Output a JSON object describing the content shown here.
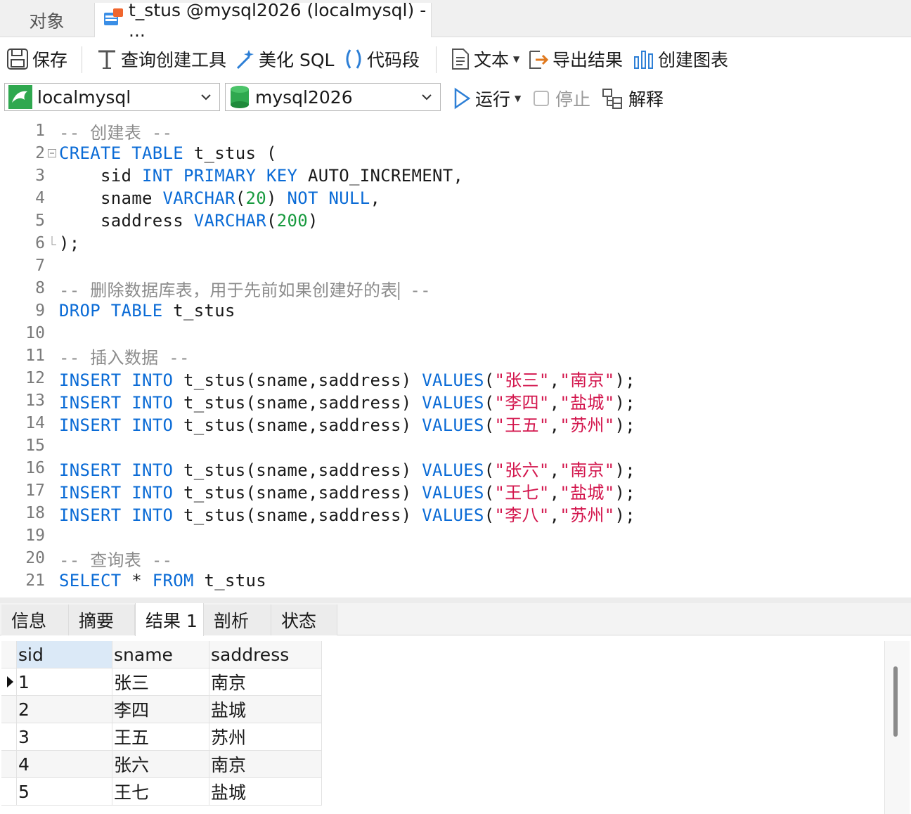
{
  "window_tabs": {
    "objects": "对象",
    "query_title": "t_stus @mysql2026 (localmysql) - ..."
  },
  "toolbar": {
    "save": "保存",
    "query_builder": "查询创建工具",
    "beautify_sql": "美化 SQL",
    "snippet": "代码段",
    "text": "文本",
    "export_result": "导出结果",
    "create_chart": "创建图表"
  },
  "toolbar2": {
    "connection": "localmysql",
    "database": "mysql2026",
    "run": "运行",
    "stop": "停止",
    "explain": "解释"
  },
  "editor": {
    "line_numbers": [
      "1",
      "2",
      "3",
      "4",
      "5",
      "6",
      "7",
      "8",
      "9",
      "10",
      "11",
      "12",
      "13",
      "14",
      "15",
      "16",
      "17",
      "18",
      "19",
      "20",
      "21"
    ],
    "lines": [
      [
        {
          "t": "-- 创建表 --",
          "c": "cmt"
        }
      ],
      [
        {
          "t": "CREATE",
          "c": "kw"
        },
        {
          "t": " ",
          "c": ""
        },
        {
          "t": "TABLE",
          "c": "kw"
        },
        {
          "t": " t_stus (",
          "c": ""
        }
      ],
      [
        {
          "t": "    sid ",
          "c": ""
        },
        {
          "t": "INT",
          "c": "kw"
        },
        {
          "t": " ",
          "c": ""
        },
        {
          "t": "PRIMARY",
          "c": "kw"
        },
        {
          "t": " ",
          "c": ""
        },
        {
          "t": "KEY",
          "c": "kw"
        },
        {
          "t": " AUTO_INCREMENT,",
          "c": ""
        }
      ],
      [
        {
          "t": "    sname ",
          "c": ""
        },
        {
          "t": "VARCHAR",
          "c": "kw"
        },
        {
          "t": "(",
          "c": ""
        },
        {
          "t": "20",
          "c": "num"
        },
        {
          "t": ") ",
          "c": ""
        },
        {
          "t": "NOT",
          "c": "kw"
        },
        {
          "t": " ",
          "c": ""
        },
        {
          "t": "NULL",
          "c": "kw"
        },
        {
          "t": ",",
          "c": ""
        }
      ],
      [
        {
          "t": "    saddress ",
          "c": ""
        },
        {
          "t": "VARCHAR",
          "c": "kw"
        },
        {
          "t": "(",
          "c": ""
        },
        {
          "t": "200",
          "c": "num"
        },
        {
          "t": ")",
          "c": ""
        }
      ],
      [
        {
          "t": ");",
          "c": ""
        }
      ],
      [],
      [
        {
          "t": "-- 删除数据库表，用于先前如果创建好的表",
          "c": "cmt"
        },
        {
          "t": "",
          "c": "caret"
        },
        {
          "t": " --",
          "c": "cmt"
        }
      ],
      [
        {
          "t": "DROP",
          "c": "kw"
        },
        {
          "t": " ",
          "c": ""
        },
        {
          "t": "TABLE",
          "c": "kw"
        },
        {
          "t": " t_stus",
          "c": ""
        }
      ],
      [],
      [
        {
          "t": "-- 插入数据 --",
          "c": "cmt"
        }
      ],
      [
        {
          "t": "INSERT",
          "c": "kw"
        },
        {
          "t": " ",
          "c": ""
        },
        {
          "t": "INTO",
          "c": "kw"
        },
        {
          "t": " t_stus(sname,saddress) ",
          "c": ""
        },
        {
          "t": "VALUES",
          "c": "kw"
        },
        {
          "t": "(",
          "c": ""
        },
        {
          "t": "\"张三\"",
          "c": "str"
        },
        {
          "t": ",",
          "c": ""
        },
        {
          "t": "\"南京\"",
          "c": "str"
        },
        {
          "t": ");",
          "c": ""
        }
      ],
      [
        {
          "t": "INSERT",
          "c": "kw"
        },
        {
          "t": " ",
          "c": ""
        },
        {
          "t": "INTO",
          "c": "kw"
        },
        {
          "t": " t_stus(sname,saddress) ",
          "c": ""
        },
        {
          "t": "VALUES",
          "c": "kw"
        },
        {
          "t": "(",
          "c": ""
        },
        {
          "t": "\"李四\"",
          "c": "str"
        },
        {
          "t": ",",
          "c": ""
        },
        {
          "t": "\"盐城\"",
          "c": "str"
        },
        {
          "t": ");",
          "c": ""
        }
      ],
      [
        {
          "t": "INSERT",
          "c": "kw"
        },
        {
          "t": " ",
          "c": ""
        },
        {
          "t": "INTO",
          "c": "kw"
        },
        {
          "t": " t_stus(sname,saddress) ",
          "c": ""
        },
        {
          "t": "VALUES",
          "c": "kw"
        },
        {
          "t": "(",
          "c": ""
        },
        {
          "t": "\"王五\"",
          "c": "str"
        },
        {
          "t": ",",
          "c": ""
        },
        {
          "t": "\"苏州\"",
          "c": "str"
        },
        {
          "t": ");",
          "c": ""
        }
      ],
      [],
      [
        {
          "t": "INSERT",
          "c": "kw"
        },
        {
          "t": " ",
          "c": ""
        },
        {
          "t": "INTO",
          "c": "kw"
        },
        {
          "t": " t_stus(sname,saddress) ",
          "c": ""
        },
        {
          "t": "VALUES",
          "c": "kw"
        },
        {
          "t": "(",
          "c": ""
        },
        {
          "t": "\"张六\"",
          "c": "str"
        },
        {
          "t": ",",
          "c": ""
        },
        {
          "t": "\"南京\"",
          "c": "str"
        },
        {
          "t": ");",
          "c": ""
        }
      ],
      [
        {
          "t": "INSERT",
          "c": "kw"
        },
        {
          "t": " ",
          "c": ""
        },
        {
          "t": "INTO",
          "c": "kw"
        },
        {
          "t": " t_stus(sname,saddress) ",
          "c": ""
        },
        {
          "t": "VALUES",
          "c": "kw"
        },
        {
          "t": "(",
          "c": ""
        },
        {
          "t": "\"王七\"",
          "c": "str"
        },
        {
          "t": ",",
          "c": ""
        },
        {
          "t": "\"盐城\"",
          "c": "str"
        },
        {
          "t": ");",
          "c": ""
        }
      ],
      [
        {
          "t": "INSERT",
          "c": "kw"
        },
        {
          "t": " ",
          "c": ""
        },
        {
          "t": "INTO",
          "c": "kw"
        },
        {
          "t": " t_stus(sname,saddress) ",
          "c": ""
        },
        {
          "t": "VALUES",
          "c": "kw"
        },
        {
          "t": "(",
          "c": ""
        },
        {
          "t": "\"李八\"",
          "c": "str"
        },
        {
          "t": ",",
          "c": ""
        },
        {
          "t": "\"苏州\"",
          "c": "str"
        },
        {
          "t": ");",
          "c": ""
        }
      ],
      [],
      [
        {
          "t": "-- 查询表 --",
          "c": "cmt"
        }
      ],
      [
        {
          "t": "SELECT",
          "c": "kw"
        },
        {
          "t": " * ",
          "c": ""
        },
        {
          "t": "FROM",
          "c": "kw"
        },
        {
          "t": " t_stus",
          "c": ""
        }
      ]
    ]
  },
  "result_tabs": [
    "信息",
    "摘要",
    "结果 1",
    "剖析",
    "状态"
  ],
  "result_grid": {
    "columns": [
      "sid",
      "sname",
      "saddress"
    ],
    "rows": [
      [
        "1",
        "张三",
        "南京"
      ],
      [
        "2",
        "李四",
        "盐城"
      ],
      [
        "3",
        "王五",
        "苏州"
      ],
      [
        "4",
        "张六",
        "南京"
      ],
      [
        "5",
        "王七",
        "盐城"
      ]
    ]
  },
  "colors": {
    "keyword": "#0a6bd6",
    "number": "#179a3e",
    "string": "#d3164d",
    "comment": "#8b8b8b"
  }
}
